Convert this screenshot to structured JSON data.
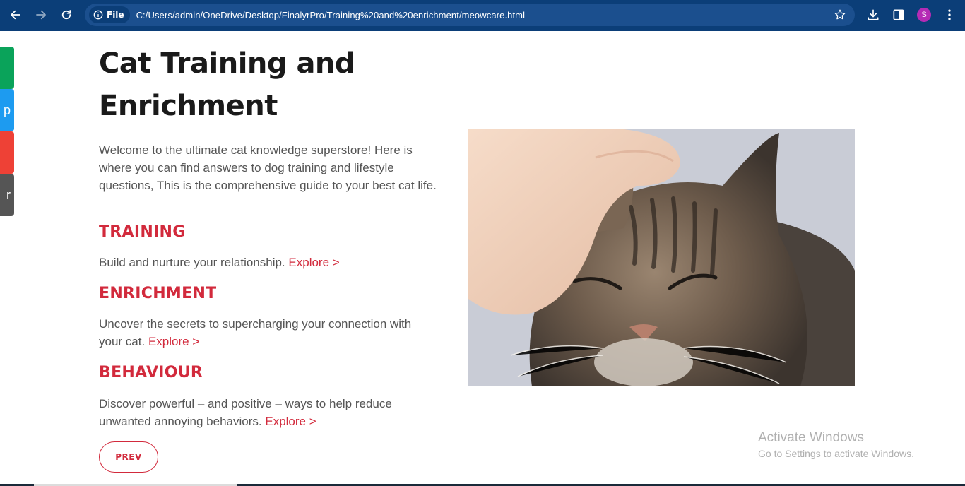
{
  "browser": {
    "scheme_label": "File",
    "url": "C:/Users/admin/OneDrive/Desktop/FinalyrPro/Training%20and%20enrichment/meowcare.html",
    "profile_initial": "S",
    "profile_color": "#b52bb5",
    "toolbar_color": "#0b3e78"
  },
  "share_tabs": [
    {
      "icon": "share-green",
      "label": "",
      "color": "#0aa35a"
    },
    {
      "icon": "pinterest-icon",
      "label": "p",
      "color": "#1d9bf0"
    },
    {
      "icon": "share-red",
      "label": "",
      "color": "#ee4136"
    },
    {
      "icon": "share-gray",
      "label": "r",
      "color": "#555555"
    }
  ],
  "page": {
    "title_line1": "Cat Training and",
    "title_line2": "Enrichment",
    "intro": "Welcome to the ultimate cat knowledge superstore! Here is where you can find answers to dog training and lifestyle questions, This is the comprehensive guide to your best cat life.",
    "sections": [
      {
        "heading": "TRAINING",
        "text": "Build and nurture your relationship.",
        "link": "Explore >"
      },
      {
        "heading": "ENRICHMENT",
        "text": "Uncover the secrets to supercharging your connection with your cat.",
        "link": "Explore >"
      },
      {
        "heading": "BEHAVIOUR",
        "text": "Discover powerful – and positive – ways to help reduce unwanted annoying behaviors.",
        "link": "Explore >"
      }
    ],
    "prev_label": "PREV",
    "accent_color": "#d22a3c"
  },
  "watermark": {
    "line1": "Activate Windows",
    "line2": "Go to Settings to activate Windows."
  }
}
